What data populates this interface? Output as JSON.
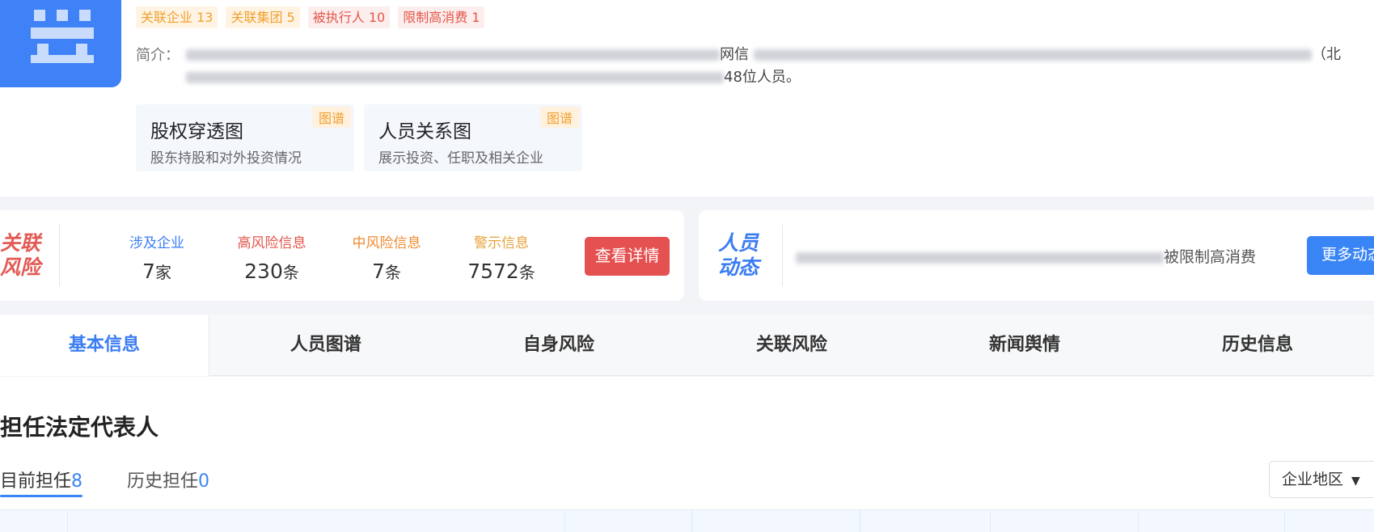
{
  "company": {
    "tags": [
      {
        "label": "关联企业 13",
        "tone": "orange"
      },
      {
        "label": "关联集团 5",
        "tone": "orange"
      },
      {
        "label": "被执行人 10",
        "tone": "red"
      },
      {
        "label": "限制高消费 1",
        "tone": "red"
      }
    ],
    "intro_label": "简介：",
    "intro_visible_1": "网信",
    "intro_visible_2": "（北",
    "intro_visible_3": "48位人员。",
    "graphs": [
      {
        "title": "股权穿透图",
        "desc": "股东持股和对外投资情况",
        "tag": "图谱"
      },
      {
        "title": "人员关系图",
        "desc": "展示投资、任职及相关企业",
        "tag": "图谱"
      }
    ]
  },
  "risk": {
    "title": "关联风险",
    "metrics": [
      {
        "label": "涉及企业",
        "value": "7",
        "unit": "家",
        "color": "#3a7cf2"
      },
      {
        "label": "高风险信息",
        "value": "230",
        "unit": "条",
        "color": "#e2564a"
      },
      {
        "label": "中风险信息",
        "value": "7",
        "unit": "条",
        "color": "#ef8a2f"
      },
      {
        "label": "警示信息",
        "value": "7572",
        "unit": "条",
        "color": "#e9a23b"
      }
    ],
    "detail_button": "查看详情"
  },
  "dynamics": {
    "title": "人员动态",
    "text_visible": "被限制高消费",
    "more_button": "更多动态"
  },
  "tabs": [
    "基本信息",
    "人员图谱",
    "自身风险",
    "关联风险",
    "新闻舆情",
    "历史信息"
  ],
  "active_tab": "基本信息",
  "section": {
    "title": "担任法定代表人",
    "subtabs": [
      {
        "label": "目前担任",
        "count": "8"
      },
      {
        "label": "历史担任",
        "count": "0"
      }
    ],
    "region_filter": "企业地区"
  },
  "colors": {
    "accent": "#3a85f5",
    "danger": "#e55050"
  }
}
